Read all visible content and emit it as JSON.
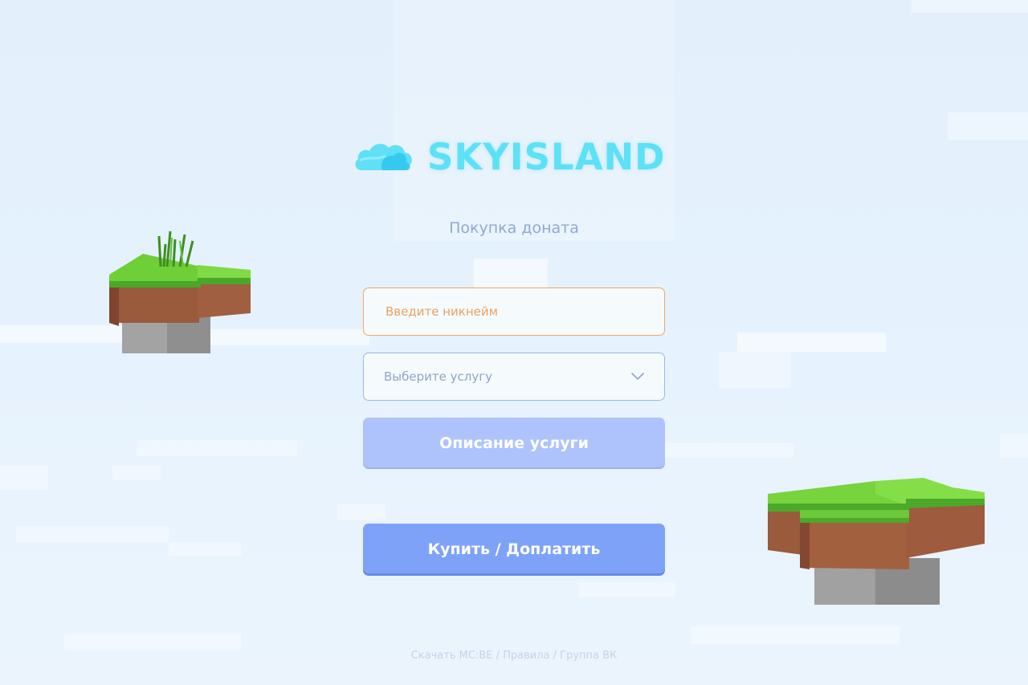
{
  "brand": {
    "name": "SKYISLAND",
    "logo_icon": "cloud-icon",
    "color": "#5ce1f6"
  },
  "page": {
    "subtitle": "Покупка доната"
  },
  "form": {
    "nickname": {
      "placeholder": "Введите никнейм",
      "value": ""
    },
    "service": {
      "placeholder": "Выберите услугу",
      "icon": "chevron-down-icon"
    },
    "describe_button": "Описание услуги",
    "buy_button": "Купить / Доплатить"
  },
  "footer": {
    "links": [
      "Скачать MC:BE",
      "Правила",
      "Группа ВК"
    ],
    "separator": " / "
  },
  "colors": {
    "nickname_border": "#f0a862",
    "service_border": "#9ab8e6",
    "describe_button": "#aec3fb",
    "buy_button": "#7fa2f9",
    "background": "#e3f0fc"
  }
}
